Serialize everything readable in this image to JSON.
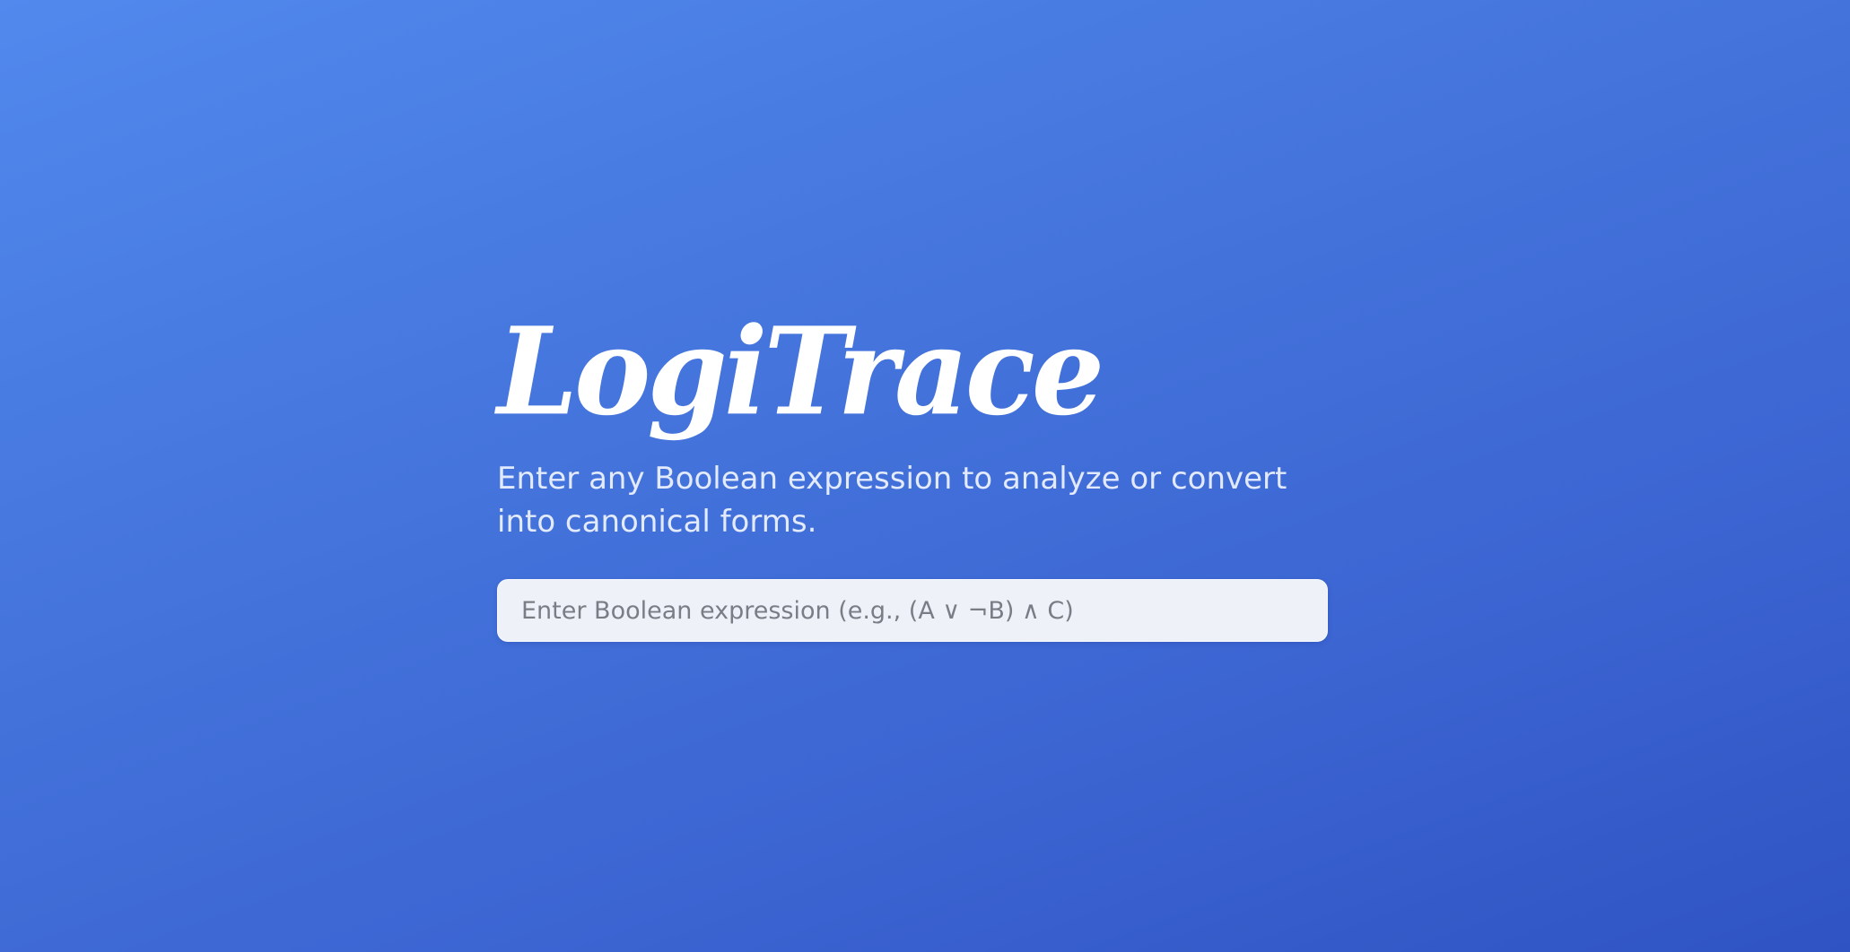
{
  "app": {
    "logo_text": "LogiTrace",
    "subtitle": "Enter any Boolean expression to analyze or convert into canonical forms."
  },
  "search": {
    "placeholder": "Enter Boolean expression (e.g., (A ∨ ¬B) ∧ C)",
    "value": ""
  },
  "colors": {
    "background_start": "#5189ed",
    "background_end": "#2f53c3",
    "input_background": "#eff1f9",
    "logo": "#ffffff"
  }
}
